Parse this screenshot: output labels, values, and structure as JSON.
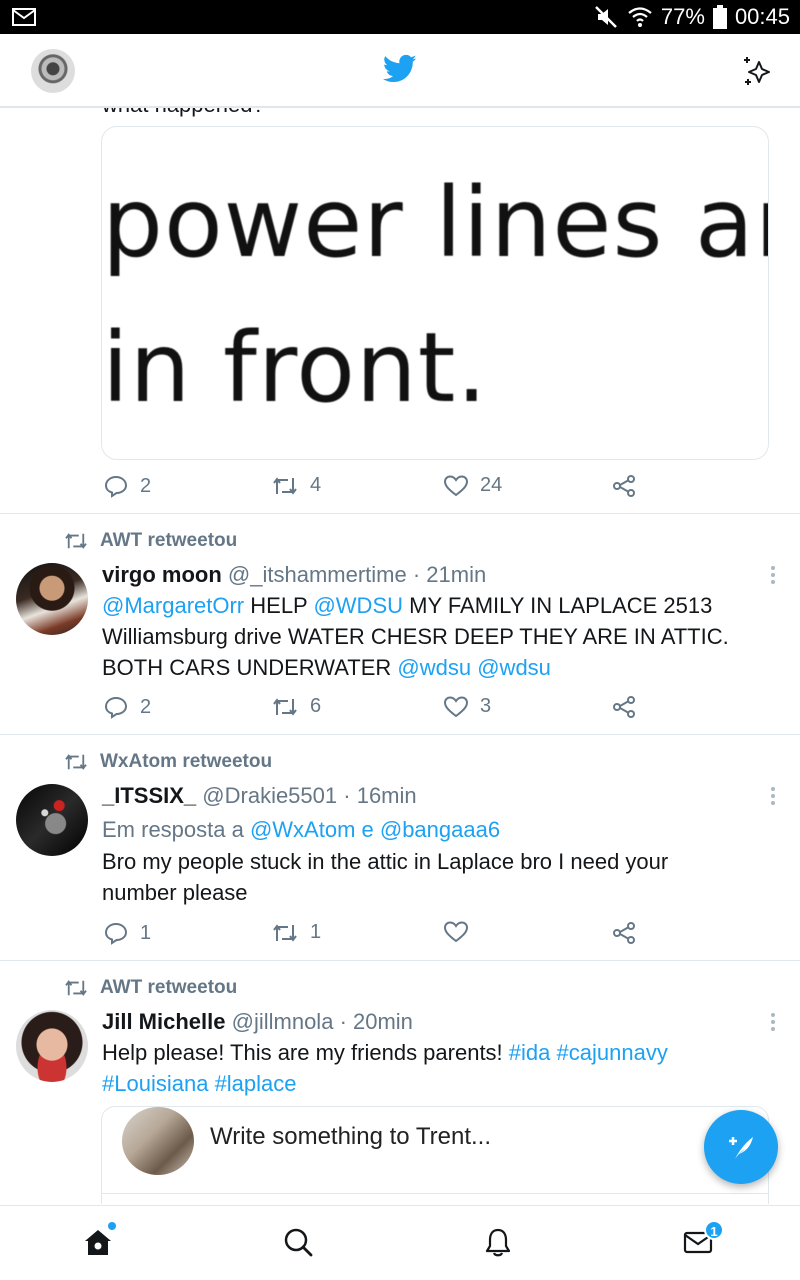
{
  "status_bar": {
    "battery": "77%",
    "time": "00:45"
  },
  "top_tweet": {
    "cut_text": "what happened?",
    "image_line1": "power lines ar",
    "image_line2": "in front.",
    "replies": "2",
    "retweets": "4",
    "likes": "24"
  },
  "tweets": [
    {
      "retweeted_by": "AWT retweetou",
      "name": "virgo moon",
      "handle": "@_itshammertime",
      "time": "· 21min",
      "body": [
        {
          "t": "@MargaretOrr",
          "link": true
        },
        {
          "t": " HELP ",
          "link": false
        },
        {
          "t": "@WDSU",
          "link": true
        },
        {
          "t": " MY FAMILY IN LAPLACE 2513 Williamsburg drive WATER CHESR DEEP THEY ARE IN ATTIC. BOTH CARS UNDERWATER ",
          "link": false
        },
        {
          "t": "@wdsu",
          "link": true
        },
        {
          "t": " ",
          "link": false
        },
        {
          "t": "@wdsu",
          "link": true
        }
      ],
      "replies": "2",
      "retweets": "6",
      "likes": "3"
    },
    {
      "retweeted_by": "WxAtom retweetou",
      "name": "_ITSSIX_",
      "handle": "@Drakie5501",
      "time": "· 16min",
      "reply_prefix": "Em resposta a ",
      "reply_to": "@WxAtom e @bangaaa6",
      "body": [
        {
          "t": "Bro my people stuck in the attic in Laplace bro I need your number please",
          "link": false
        }
      ],
      "replies": "1",
      "retweets": "1",
      "likes": ""
    },
    {
      "retweeted_by": "AWT retweetou",
      "name": "Jill Michelle",
      "handle": "@jillmnola",
      "time": "· 20min",
      "body": [
        {
          "t": "Help please! This are my friends parents! ",
          "link": false
        },
        {
          "t": "#ida",
          "link": true
        },
        {
          "t": " ",
          "link": false
        },
        {
          "t": "#cajunnavy",
          "link": true
        },
        {
          "t": " ",
          "link": false
        },
        {
          "t": "#Louisiana",
          "link": true
        },
        {
          "t": " ",
          "link": false
        },
        {
          "t": "#laplace",
          "link": true
        }
      ],
      "embedded_text": "Write something to Trent..."
    }
  ],
  "bottom_nav": {
    "messages_badge": "1"
  },
  "colors": {
    "accent": "#1da1f2",
    "muted": "#657786",
    "border": "#e1e8ed"
  }
}
